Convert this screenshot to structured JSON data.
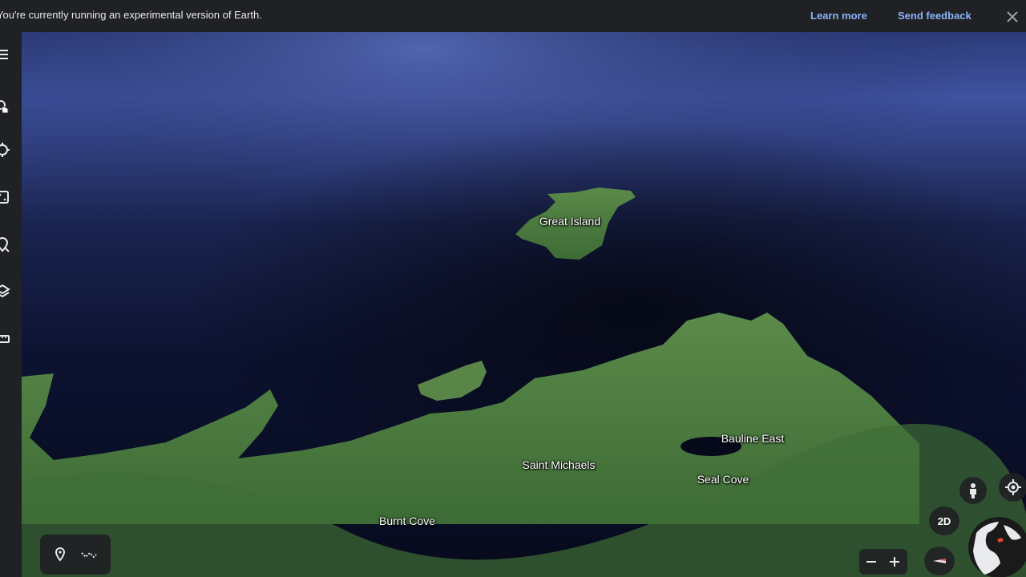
{
  "banner": {
    "message": "You're currently running an experimental version of Earth.",
    "learn_more": "Learn more",
    "send_feedback": "Send feedback"
  },
  "rail": {
    "items": [
      {
        "icon": "menu-icon"
      },
      {
        "icon": "search-icon"
      },
      {
        "icon": "voyager-icon"
      },
      {
        "icon": "dice-icon"
      },
      {
        "icon": "projects-icon"
      },
      {
        "icon": "layers-icon"
      },
      {
        "icon": "ruler-icon"
      }
    ]
  },
  "map": {
    "places": [
      {
        "name": "Great Island"
      },
      {
        "name": "Saint Michaels"
      },
      {
        "name": "Bauline East"
      },
      {
        "name": "Seal Cove"
      },
      {
        "name": "Burnt Cove"
      }
    ]
  },
  "controls": {
    "toggle_2d": "2D",
    "zoom_out": "−",
    "zoom_in": "+"
  },
  "colors": {
    "banner_bg": "#202124",
    "link": "#8ab4f8",
    "ocean_dark": "#0a0f24",
    "ocean_light": "#4a5fa3",
    "land": "#4a7a3e"
  }
}
